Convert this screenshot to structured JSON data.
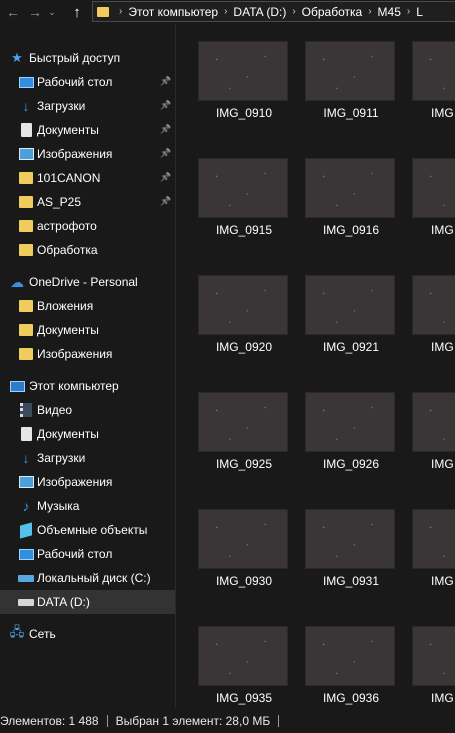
{
  "address": {
    "segments": [
      "Этот компьютер",
      "DATA (D:)",
      "Обработка",
      "M45",
      "L"
    ]
  },
  "sidebar": {
    "items": [
      {
        "label": "Быстрый доступ",
        "icon": "star-icon",
        "level": 0,
        "pinned": false,
        "selected": false
      },
      {
        "label": "Рабочий стол",
        "icon": "desktop-icon",
        "level": 1,
        "pinned": true,
        "selected": false
      },
      {
        "label": "Загрузки",
        "icon": "download-icon",
        "level": 1,
        "pinned": true,
        "selected": false
      },
      {
        "label": "Документы",
        "icon": "documents-icon",
        "level": 1,
        "pinned": true,
        "selected": false
      },
      {
        "label": "Изображения",
        "icon": "pictures-icon",
        "level": 1,
        "pinned": true,
        "selected": false
      },
      {
        "label": "101CANON",
        "icon": "folder-icon",
        "level": 1,
        "pinned": true,
        "selected": false
      },
      {
        "label": "AS_P25",
        "icon": "folder-icon",
        "level": 1,
        "pinned": true,
        "selected": false
      },
      {
        "label": "астрофото",
        "icon": "folder-icon",
        "level": 1,
        "pinned": false,
        "selected": false
      },
      {
        "label": "Обработка",
        "icon": "folder-icon",
        "level": 1,
        "pinned": false,
        "selected": false
      },
      {
        "label": "OneDrive - Personal",
        "icon": "cloud-icon",
        "level": 0,
        "pinned": false,
        "selected": false
      },
      {
        "label": "Вложения",
        "icon": "folder-icon",
        "level": 1,
        "pinned": false,
        "selected": false
      },
      {
        "label": "Документы",
        "icon": "folder-icon",
        "level": 1,
        "pinned": false,
        "selected": false
      },
      {
        "label": "Изображения",
        "icon": "folder-icon",
        "level": 1,
        "pinned": false,
        "selected": false
      },
      {
        "label": "Этот компьютер",
        "icon": "computer-icon",
        "level": 0,
        "pinned": false,
        "selected": false
      },
      {
        "label": "Видео",
        "icon": "video-icon",
        "level": 1,
        "pinned": false,
        "selected": false
      },
      {
        "label": "Документы",
        "icon": "documents-icon",
        "level": 1,
        "pinned": false,
        "selected": false
      },
      {
        "label": "Загрузки",
        "icon": "download-icon",
        "level": 1,
        "pinned": false,
        "selected": false
      },
      {
        "label": "Изображения",
        "icon": "pictures-icon",
        "level": 1,
        "pinned": false,
        "selected": false
      },
      {
        "label": "Музыка",
        "icon": "music-icon",
        "level": 1,
        "pinned": false,
        "selected": false
      },
      {
        "label": "Объемные объекты",
        "icon": "3d-objects-icon",
        "level": 1,
        "pinned": false,
        "selected": false
      },
      {
        "label": "Рабочий стол",
        "icon": "desktop-icon",
        "level": 1,
        "pinned": false,
        "selected": false
      },
      {
        "label": "Локальный диск (C:)",
        "icon": "system-drive-icon",
        "level": 1,
        "pinned": false,
        "selected": false
      },
      {
        "label": "DATA (D:)",
        "icon": "drive-icon",
        "level": 1,
        "pinned": false,
        "selected": true
      },
      {
        "label": "Сеть",
        "icon": "network-icon",
        "level": 0,
        "pinned": false,
        "selected": false
      }
    ]
  },
  "files": {
    "rows": [
      [
        "IMG_0910",
        "IMG_0911",
        "IMG"
      ],
      [
        "IMG_0915",
        "IMG_0916",
        "IMG"
      ],
      [
        "IMG_0920",
        "IMG_0921",
        "IMG"
      ],
      [
        "IMG_0925",
        "IMG_0926",
        "IMG"
      ],
      [
        "IMG_0930",
        "IMG_0931",
        "IMG"
      ],
      [
        "IMG_0935",
        "IMG_0936",
        "IMG"
      ]
    ]
  },
  "status": {
    "items_count": "Элементов: 1 488",
    "selection": "Выбран 1 элемент: 28,0 МБ"
  },
  "colors": {
    "background": "#191919",
    "selected": "#333333",
    "folder": "#f2cb5f",
    "accent": "#2f8fe0"
  }
}
